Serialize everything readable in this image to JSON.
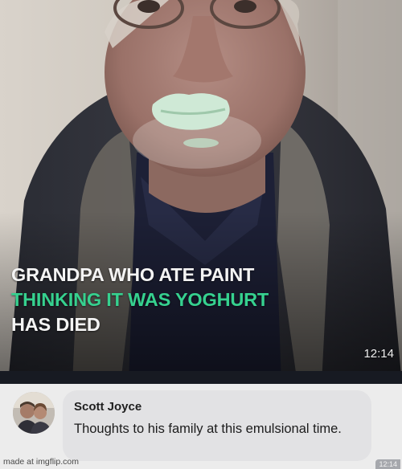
{
  "video": {
    "caption_line1": "GRANDPA WHO ATE PAINT",
    "caption_line2": "THINKING IT WAS YOGHURT",
    "caption_line3": "HAS DIED",
    "timestamp": "12:14"
  },
  "comment": {
    "author": "Scott Joyce",
    "text": "Thoughts to his family at this emulsional time."
  },
  "footer": {
    "watermark": "made at imgflip.com",
    "corner_time": "12:14"
  },
  "colors": {
    "caption_white": "#f4f4f4",
    "caption_green": "#36d18f",
    "paint_green": "#cfe9d6",
    "bubble": "#e2e2e4"
  }
}
